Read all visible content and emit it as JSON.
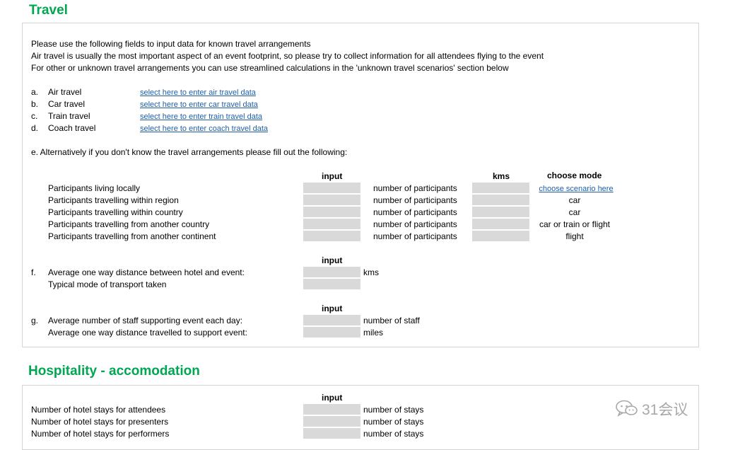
{
  "travel": {
    "title": "Travel",
    "intro": [
      "Please use the following fields to input data for known travel arrangements",
      "Air travel is usually the most important aspect of an event footprint, so please try to collect information for all attendees flying to the event",
      "For other or unknown travel arrangements you can use streamlined calculations in the 'unknown travel scenarios' section below"
    ],
    "known": [
      {
        "letter": "a.",
        "label": "Air travel",
        "link": "select here to enter air travel data"
      },
      {
        "letter": "b.",
        "label": "Car travel",
        "link": "select here to enter car travel data"
      },
      {
        "letter": "c.",
        "label": "Train travel",
        "link": "select here to enter train travel data"
      },
      {
        "letter": "d.",
        "label": "Coach travel",
        "link": "select here to enter coach travel data"
      }
    ],
    "alt_text": "e. Alternatively if you don't know the travel arrangements please fill out the following:",
    "headers": {
      "input": "input",
      "kms": "kms",
      "mode": "choose mode"
    },
    "participants": [
      {
        "label": "Participants living locally",
        "unit": "number of participants",
        "mode": "choose scenario here",
        "mode_is_link": true
      },
      {
        "label": "Participants travelling within region",
        "unit": "number of participants",
        "mode": "car"
      },
      {
        "label": "Participants travelling within country",
        "unit": "number of participants",
        "mode": "car"
      },
      {
        "label": "Participants travelling from another country",
        "unit": "number of participants",
        "mode": "car or train or flight"
      },
      {
        "label": "Participants travelling from another continent",
        "unit": "number of participants",
        "mode": "flight"
      }
    ],
    "f": {
      "header": "input",
      "letter": "f.",
      "row1_label": "Average one way distance between hotel and event:",
      "row1_unit": "kms",
      "row2_label": "Typical mode of transport taken"
    },
    "g": {
      "header": "input",
      "letter": "g.",
      "row1_label": "Average number of staff supporting event each day:",
      "row1_unit": "number of staff",
      "row2_label": "Average one way distance travelled to support event:",
      "row2_unit": "miles"
    }
  },
  "hospitality": {
    "title": "Hospitality - accomodation",
    "header": "input",
    "rows": [
      {
        "label": "Number of hotel stays for attendees",
        "unit": "number of stays"
      },
      {
        "label": "Number of hotel stays for presenters",
        "unit": "number of stays"
      },
      {
        "label": "Number of hotel stays for performers",
        "unit": "number of stays"
      }
    ]
  },
  "watermark": {
    "text": "31会议",
    "icon": "wechat-icon"
  },
  "colors": {
    "title_green": "#00a651",
    "link_blue": "#1f5fa8",
    "input_grey": "#d9d9d9",
    "panel_border": "#d4d4d4"
  }
}
